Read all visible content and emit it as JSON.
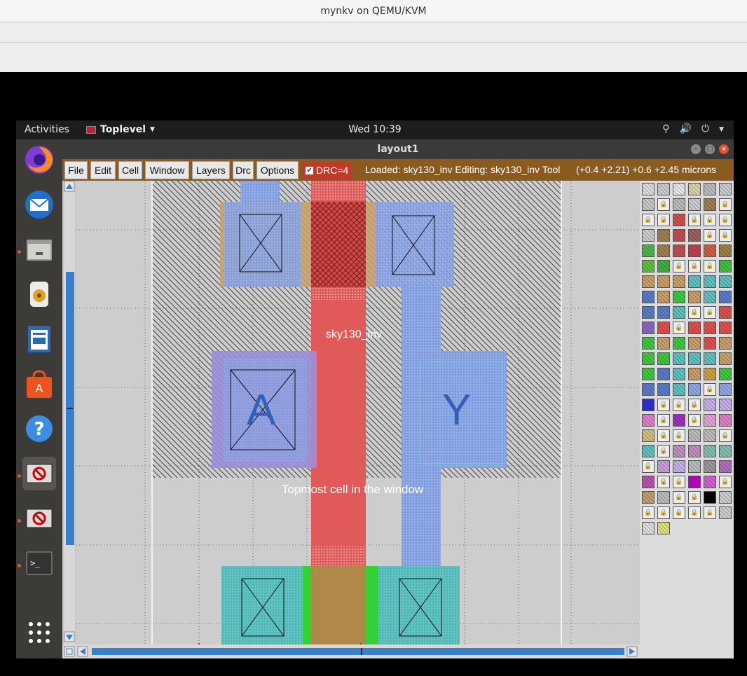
{
  "host": {
    "title": "mynkv on QEMU/KVM"
  },
  "topbar": {
    "activities": "Activities",
    "app_name": "Toplevel",
    "clock": "Wed 10:39",
    "tray_icons": [
      "accessibility-icon",
      "volume-icon",
      "power-icon",
      "chevron-down-icon"
    ]
  },
  "dock": {
    "apps": [
      {
        "name": "firefox",
        "running": false
      },
      {
        "name": "thunderbird",
        "running": false
      },
      {
        "name": "files",
        "running": true
      },
      {
        "name": "rhythmbox",
        "running": false
      },
      {
        "name": "libreoffice-writer",
        "running": false
      },
      {
        "name": "software-center",
        "running": false
      },
      {
        "name": "help",
        "running": false
      },
      {
        "name": "magic-layout",
        "running": true
      },
      {
        "name": "magic-console",
        "running": true
      },
      {
        "name": "terminal",
        "running": true
      },
      {
        "name": "show-applications",
        "running": false
      }
    ]
  },
  "window": {
    "title": "layout1",
    "menu": [
      "File",
      "Edit",
      "Cell",
      "Window",
      "Layers",
      "Drc",
      "Options"
    ],
    "drc_label": "DRC=4",
    "drc_checked": true,
    "status": "Loaded: sky130_inv Editing: sky130_inv Tool",
    "coords": "(+0.4 +2.21) +0.6 +2.45 microns"
  },
  "layout": {
    "cell_name": "sky130_inv",
    "label_a": "A",
    "label_y": "Y",
    "tooltip": "Topmost cell in the window"
  },
  "colors": {
    "poly": "#e05a5a",
    "li": "#8ea8e8",
    "diff": "#5ec8c0",
    "pdiff": "#c8a068",
    "tap": "#32d232",
    "menubar": "#8a5a1f"
  }
}
